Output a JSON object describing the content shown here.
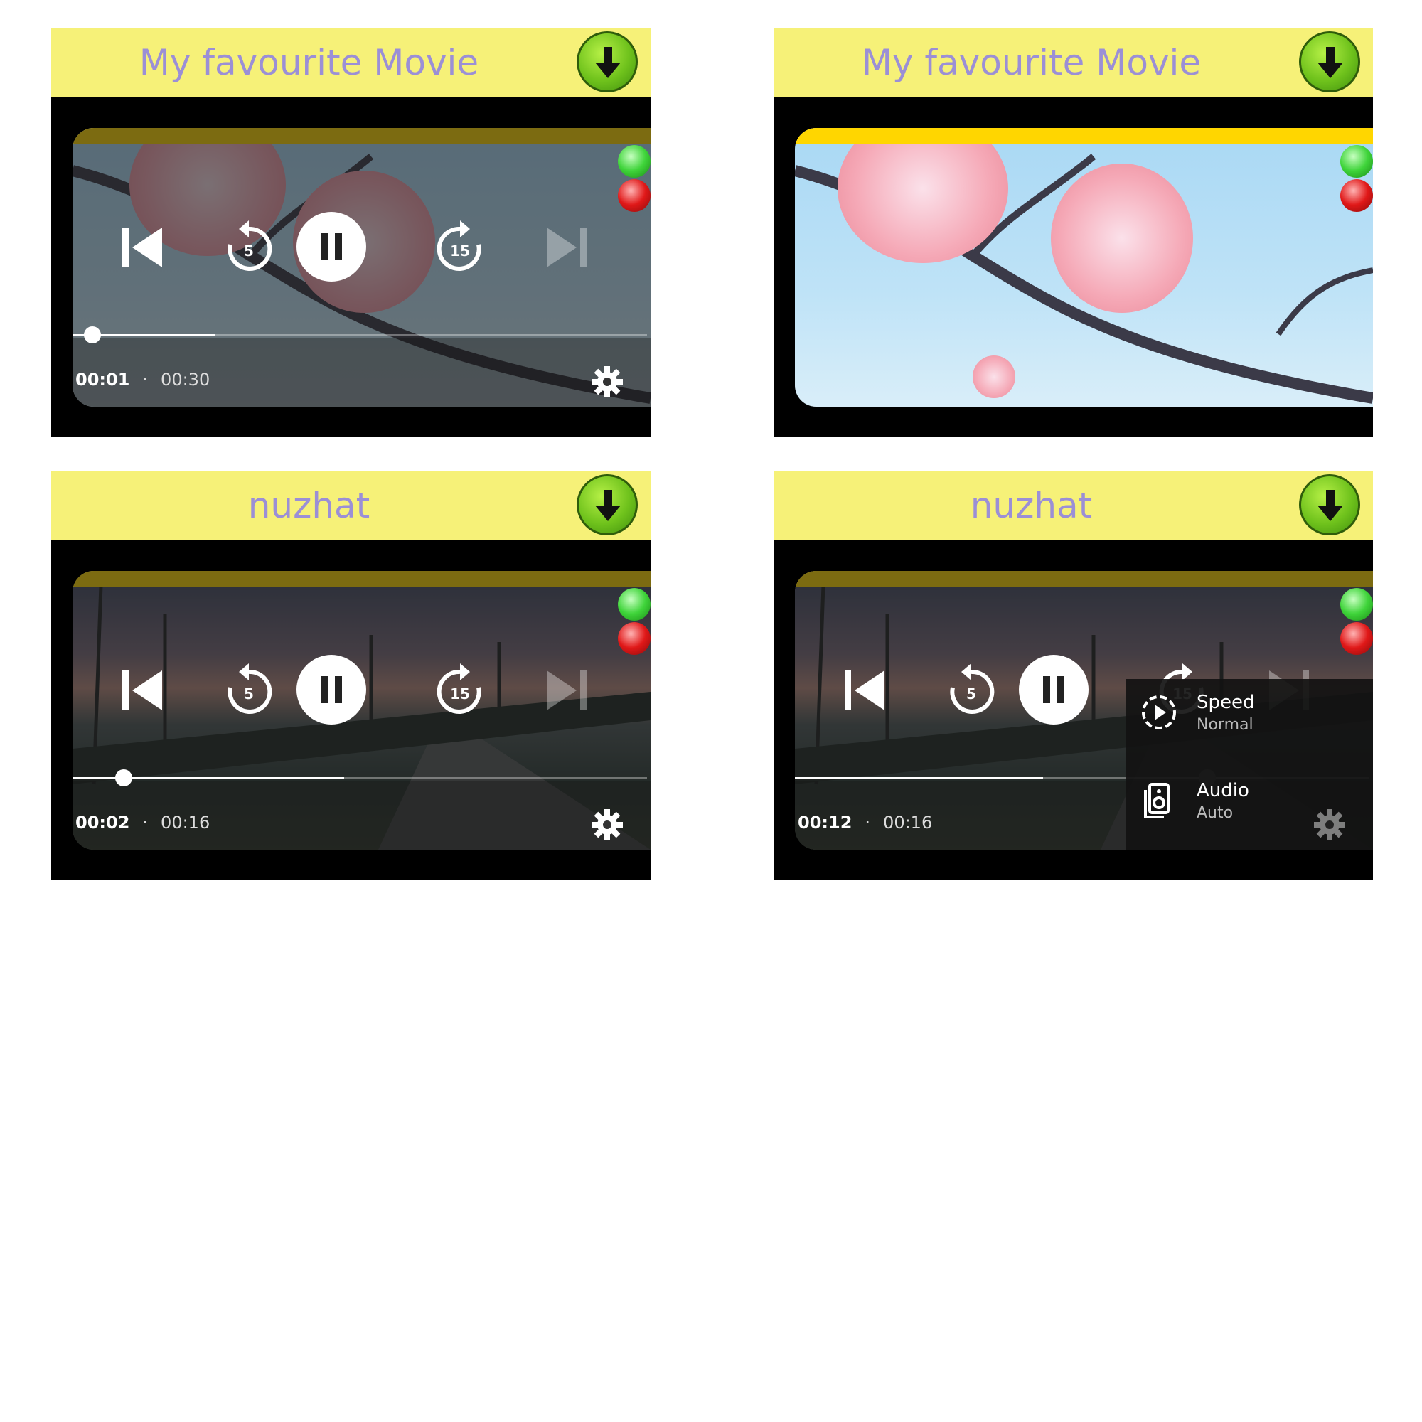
{
  "panels": [
    {
      "title": "My favourite Movie",
      "current_time": "00:01",
      "separator": "·",
      "duration": "00:30"
    },
    {
      "title": "My favourite Movie"
    },
    {
      "title": "nuzhat",
      "current_time": "00:02",
      "separator": "·",
      "duration": "00:16"
    },
    {
      "title": "nuzhat",
      "current_time": "00:12",
      "separator": "·",
      "duration": "00:16",
      "settings_menu": {
        "speed": {
          "label": "Speed",
          "value": "Normal"
        },
        "audio": {
          "label": "Audio",
          "value": "Auto"
        }
      }
    }
  ],
  "controls": {
    "rewind_seconds": "5",
    "forward_seconds": "15"
  },
  "icons": [
    "download-icon",
    "previous-icon",
    "rewind-icon",
    "pause-icon",
    "forward-icon",
    "next-icon",
    "settings-icon",
    "speed-icon",
    "audio-icon"
  ],
  "colors": {
    "header_bg": "#f6f178",
    "title_text": "#9b8fd6",
    "download_green": "#6fc21c",
    "status_bar": "#ffd600"
  },
  "progress": {
    "panel1": 0.04,
    "panel3": 0.09,
    "panel4": 0.75
  }
}
